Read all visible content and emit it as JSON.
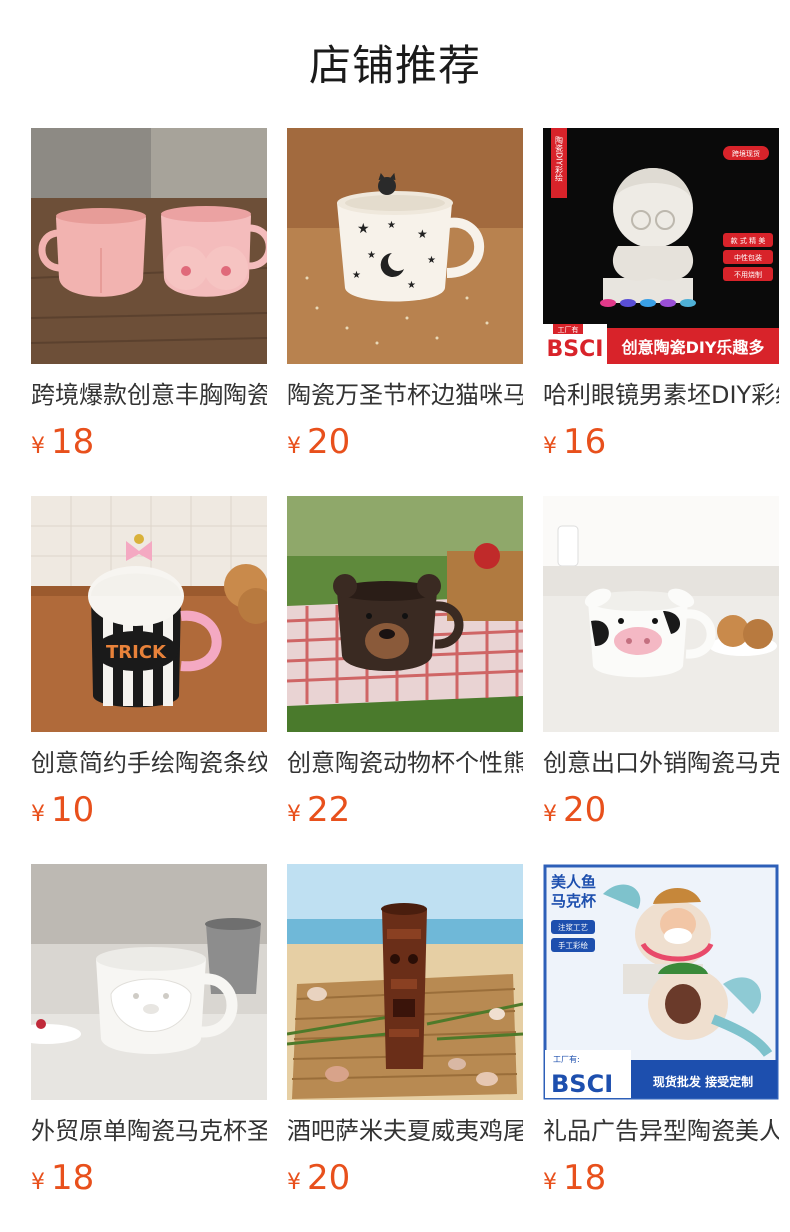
{
  "section": {
    "title": "店铺推荐"
  },
  "currency_symbol": "¥",
  "colors": {
    "price": "#e8501c",
    "title": "#1a1a1a",
    "name": "#333333"
  },
  "products": [
    {
      "name": "跨境爆款创意丰胸陶瓷马克杯",
      "price": "18",
      "image_icon": "pink-body-mugs-image"
    },
    {
      "name": "陶瓷万圣节杯边猫咪马克杯",
      "price": "20",
      "image_icon": "star-moon-cat-mug-image"
    },
    {
      "name": "哈利眼镜男素坯DIY彩绘",
      "price": "16",
      "image_icon": "diy-figure-image",
      "image_text": {
        "side_label": "陶瓷DIY彩绘",
        "top_tag": "跨境现货",
        "tags": [
          "款 式 精 美",
          "中性包装",
          "不用烧制"
        ],
        "bsci_label": "工厂有",
        "bsci": "BSCI",
        "banner": "创意陶瓷DIY乐趣多"
      }
    },
    {
      "name": "创意简约手绘陶瓷条纹马克杯",
      "price": "10",
      "image_icon": "trick-striped-jar-image",
      "image_text": {
        "mug_text": "TRICK"
      }
    },
    {
      "name": "创意陶瓷动物杯个性熊马克杯",
      "price": "22",
      "image_icon": "bear-mug-image"
    },
    {
      "name": "创意出口外销陶瓷马克杯",
      "price": "20",
      "image_icon": "cow-mug-image"
    },
    {
      "name": "外贸原单陶瓷马克杯圣诞老人",
      "price": "18",
      "image_icon": "santa-mug-image"
    },
    {
      "name": "酒吧萨米夫夏威夷鸡尾酒杯",
      "price": "20",
      "image_icon": "tiki-mug-image"
    },
    {
      "name": "礼品广告异型陶瓷美人鱼马克杯",
      "price": "18",
      "image_icon": "mermaid-mug-image",
      "image_text": {
        "title_line1": "美人鱼",
        "title_line2": "马克杯",
        "tag1": "注浆工艺",
        "tag2": "手工彩绘",
        "factory": "工厂有:",
        "bsci": "BSCI",
        "banner": "现货批发 接受定制"
      }
    }
  ]
}
